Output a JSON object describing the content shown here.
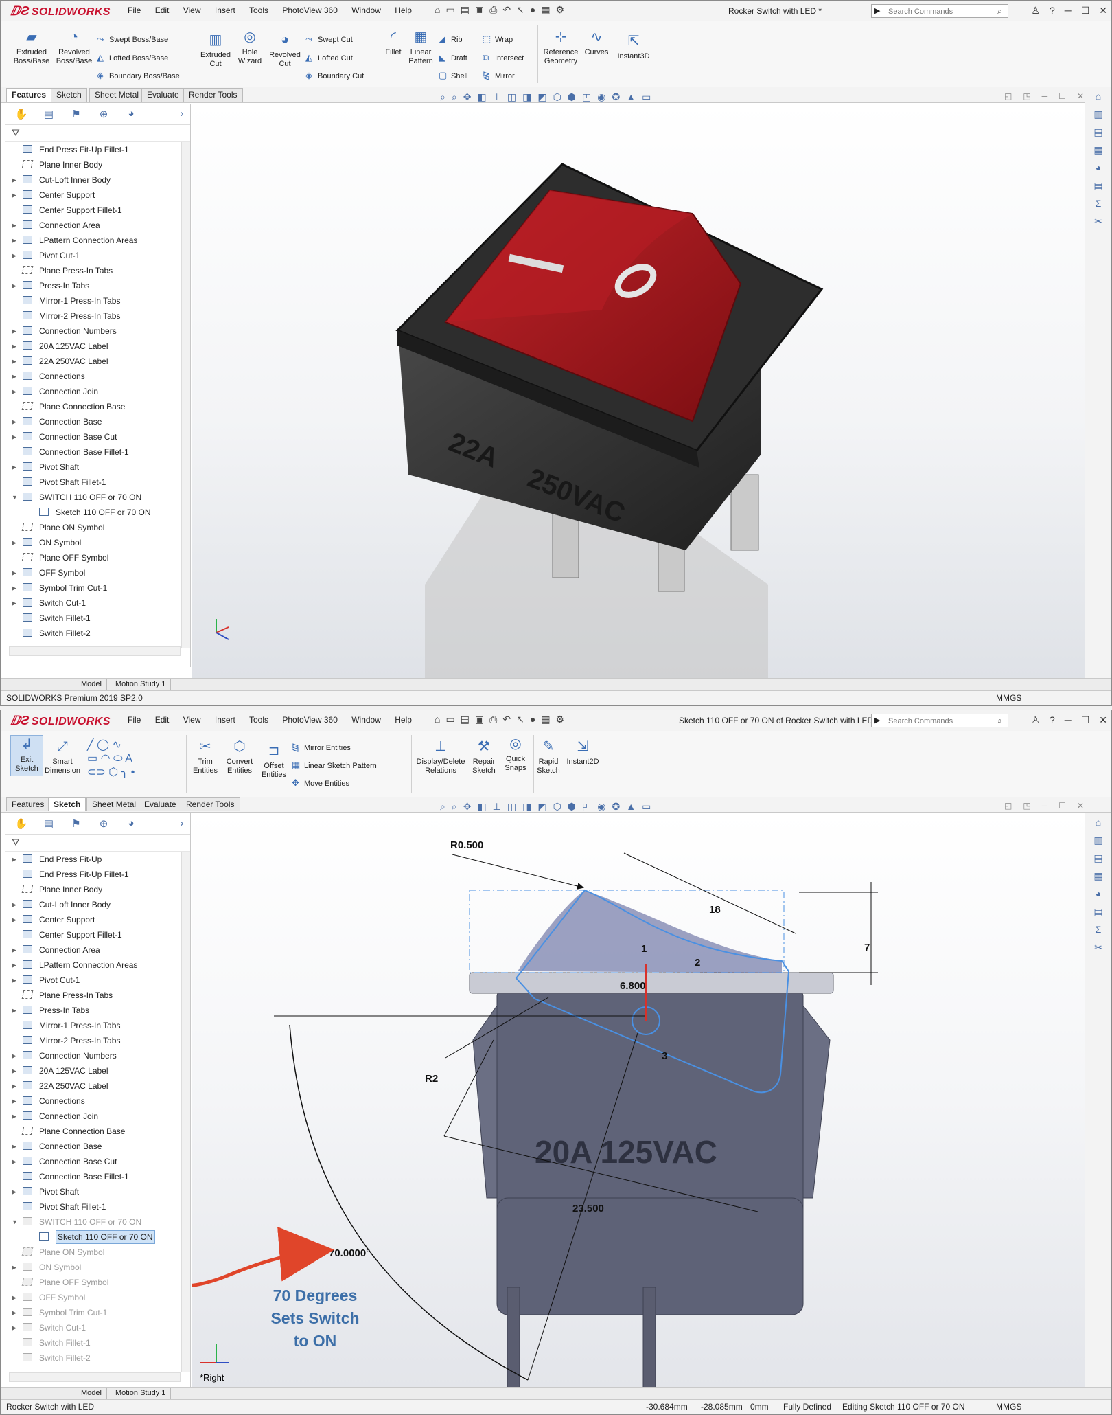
{
  "app": {
    "brand": "SOLIDWORKS",
    "menus": [
      "File",
      "Edit",
      "View",
      "Insert",
      "Tools",
      "PhotoView 360",
      "Window",
      "Help"
    ],
    "search_placeholder": "Search Commands"
  },
  "window1": {
    "title": "Rocker Switch with LED *",
    "ribbon_large": [
      {
        "label": "Extruded\nBoss/Base",
        "icon": "extrude-icon"
      },
      {
        "label": "Revolved\nBoss/Base",
        "icon": "revolve-icon"
      },
      {
        "label": "Extruded\nCut",
        "icon": "extruded-cut-icon"
      },
      {
        "label": "Hole\nWizard",
        "icon": "hole-wizard-icon"
      },
      {
        "label": "Revolved\nCut",
        "icon": "revolved-cut-icon"
      },
      {
        "label": "Fillet",
        "icon": "fillet-icon"
      },
      {
        "label": "Linear\nPattern",
        "icon": "linear-pattern-icon"
      },
      {
        "label": "Reference\nGeometry",
        "icon": "reference-geometry-icon"
      },
      {
        "label": "Curves",
        "icon": "curves-icon"
      },
      {
        "label": "Instant3D",
        "icon": "instant3d-icon"
      }
    ],
    "ribbon_small": [
      "Swept Boss/Base",
      "Lofted Boss/Base",
      "Boundary Boss/Base",
      "Swept Cut",
      "Lofted Cut",
      "Boundary Cut",
      "Rib",
      "Draft",
      "Shell",
      "Wrap",
      "Intersect",
      "Mirror"
    ],
    "tabs": [
      "Features",
      "Sketch",
      "Sheet Metal",
      "Evaluate",
      "Render Tools"
    ],
    "active_tab": "Features",
    "tree": [
      {
        "label": "End Press Fit-Up Fillet-1",
        "type": "feature",
        "exp": false
      },
      {
        "label": "Plane Inner Body",
        "type": "plane",
        "exp": false
      },
      {
        "label": "Cut-Loft Inner Body",
        "type": "feature",
        "exp": true
      },
      {
        "label": "Center Support",
        "type": "feature",
        "exp": true
      },
      {
        "label": "Center Support Fillet-1",
        "type": "feature",
        "exp": false
      },
      {
        "label": "Connection Area",
        "type": "feature",
        "exp": true
      },
      {
        "label": "LPattern Connection Areas",
        "type": "feature",
        "exp": true
      },
      {
        "label": "Pivot Cut-1",
        "type": "feature",
        "exp": true
      },
      {
        "label": "Plane Press-In Tabs",
        "type": "plane",
        "exp": false
      },
      {
        "label": "Press-In Tabs",
        "type": "feature",
        "exp": true
      },
      {
        "label": "Mirror-1 Press-In Tabs",
        "type": "feature",
        "exp": false
      },
      {
        "label": "Mirror-2 Press-In Tabs",
        "type": "feature",
        "exp": false
      },
      {
        "label": "Connection Numbers",
        "type": "feature",
        "exp": true
      },
      {
        "label": "20A  125VAC Label",
        "type": "feature",
        "exp": true
      },
      {
        "label": "22A  250VAC Label",
        "type": "feature",
        "exp": true
      },
      {
        "label": "Connections",
        "type": "feature",
        "exp": true
      },
      {
        "label": "Connection Join",
        "type": "feature",
        "exp": true
      },
      {
        "label": "Plane Connection Base",
        "type": "plane",
        "exp": false
      },
      {
        "label": "Connection Base",
        "type": "feature",
        "exp": true
      },
      {
        "label": "Connection Base Cut",
        "type": "feature",
        "exp": true
      },
      {
        "label": "Connection Base Fillet-1",
        "type": "feature",
        "exp": false
      },
      {
        "label": "Pivot Shaft",
        "type": "feature",
        "exp": true
      },
      {
        "label": "Pivot Shaft Fillet-1",
        "type": "feature",
        "exp": false
      },
      {
        "label": "SWITCH 110 OFF or 70 ON",
        "type": "feature",
        "exp": "open"
      },
      {
        "label": "Sketch 110 OFF or 70 ON",
        "type": "sketch",
        "exp": false
      },
      {
        "label": "Plane ON Symbol",
        "type": "plane",
        "exp": false
      },
      {
        "label": "ON Symbol",
        "type": "feature",
        "exp": true
      },
      {
        "label": "Plane OFF Symbol",
        "type": "plane",
        "exp": false
      },
      {
        "label": "OFF Symbol",
        "type": "feature",
        "exp": true
      },
      {
        "label": "Symbol Trim Cut-1",
        "type": "feature",
        "exp": true
      },
      {
        "label": "Switch Cut-1",
        "type": "feature",
        "exp": true
      },
      {
        "label": "Switch Fillet-1",
        "type": "feature",
        "exp": false
      },
      {
        "label": "Switch Fillet-2",
        "type": "feature",
        "exp": false
      }
    ],
    "bottom_tabs": [
      "Model",
      "Motion Study 1"
    ],
    "status_left": "SOLIDWORKS Premium 2019 SP2.0",
    "status_units": "MMGS",
    "model_text": [
      "22A",
      "250VAC"
    ],
    "symbol_on": "I",
    "symbol_off": "O"
  },
  "window2": {
    "title": "Sketch 110 OFF or 70 ON of Rocker Switch with LED *",
    "ribbon_large": [
      {
        "label": "Exit\nSketch",
        "icon": "exit-sketch-icon"
      },
      {
        "label": "Smart\nDimension",
        "icon": "smart-dimension-icon"
      },
      {
        "label": "Trim\nEntities",
        "icon": "trim-entities-icon"
      },
      {
        "label": "Convert\nEntities",
        "icon": "convert-entities-icon"
      },
      {
        "label": "Offset\nEntities",
        "icon": "offset-entities-icon"
      },
      {
        "label": "Display/Delete\nRelations",
        "icon": "relations-icon"
      },
      {
        "label": "Repair\nSketch",
        "icon": "repair-sketch-icon"
      },
      {
        "label": "Quick\nSnaps",
        "icon": "quick-snaps-icon"
      },
      {
        "label": "Rapid\nSketch",
        "icon": "rapid-sketch-icon"
      },
      {
        "label": "Instant2D",
        "icon": "instant2d-icon"
      }
    ],
    "ribbon_small": [
      "Mirror Entities",
      "Linear Sketch Pattern",
      "Move Entities"
    ],
    "tabs": [
      "Features",
      "Sketch",
      "Sheet Metal",
      "Evaluate",
      "Render Tools"
    ],
    "active_tab": "Sketch",
    "tree": [
      {
        "label": "End Press Fit-Up",
        "type": "feature",
        "exp": true
      },
      {
        "label": "End Press Fit-Up Fillet-1",
        "type": "feature",
        "exp": false
      },
      {
        "label": "Plane Inner Body",
        "type": "plane",
        "exp": false
      },
      {
        "label": "Cut-Loft Inner Body",
        "type": "feature",
        "exp": true
      },
      {
        "label": "Center Support",
        "type": "feature",
        "exp": true
      },
      {
        "label": "Center Support Fillet-1",
        "type": "feature",
        "exp": false
      },
      {
        "label": "Connection Area",
        "type": "feature",
        "exp": true
      },
      {
        "label": "LPattern Connection Areas",
        "type": "feature",
        "exp": true
      },
      {
        "label": "Pivot Cut-1",
        "type": "feature",
        "exp": true
      },
      {
        "label": "Plane Press-In Tabs",
        "type": "plane",
        "exp": false
      },
      {
        "label": "Press-In Tabs",
        "type": "feature",
        "exp": true
      },
      {
        "label": "Mirror-1 Press-In Tabs",
        "type": "feature",
        "exp": false
      },
      {
        "label": "Mirror-2 Press-In Tabs",
        "type": "feature",
        "exp": false
      },
      {
        "label": "Connection Numbers",
        "type": "feature",
        "exp": true
      },
      {
        "label": "20A  125VAC Label",
        "type": "feature",
        "exp": true
      },
      {
        "label": "22A  250VAC Label",
        "type": "feature",
        "exp": true
      },
      {
        "label": "Connections",
        "type": "feature",
        "exp": true
      },
      {
        "label": "Connection Join",
        "type": "feature",
        "exp": true
      },
      {
        "label": "Plane Connection Base",
        "type": "plane",
        "exp": false
      },
      {
        "label": "Connection Base",
        "type": "feature",
        "exp": true
      },
      {
        "label": "Connection Base Cut",
        "type": "feature",
        "exp": true
      },
      {
        "label": "Connection Base Fillet-1",
        "type": "feature",
        "exp": false
      },
      {
        "label": "Pivot Shaft",
        "type": "feature",
        "exp": true
      },
      {
        "label": "Pivot Shaft Fillet-1",
        "type": "feature",
        "exp": false
      },
      {
        "label": "SWITCH 110 OFF or 70 ON",
        "type": "feature",
        "exp": "open",
        "dim": true
      },
      {
        "label": "Sketch 110 OFF or 70 ON",
        "type": "sketch",
        "exp": false,
        "sel": true
      },
      {
        "label": "Plane ON Symbol",
        "type": "plane",
        "exp": false,
        "dim": true
      },
      {
        "label": "ON Symbol",
        "type": "feature",
        "exp": true,
        "dim": true
      },
      {
        "label": "Plane OFF Symbol",
        "type": "plane",
        "exp": false,
        "dim": true
      },
      {
        "label": "OFF Symbol",
        "type": "feature",
        "exp": true,
        "dim": true
      },
      {
        "label": "Symbol Trim Cut-1",
        "type": "feature",
        "exp": true,
        "dim": true
      },
      {
        "label": "Switch Cut-1",
        "type": "feature",
        "exp": true,
        "dim": true
      },
      {
        "label": "Switch Fillet-1",
        "type": "feature",
        "exp": false,
        "dim": true
      },
      {
        "label": "Switch Fillet-2",
        "type": "feature",
        "exp": false,
        "dim": true
      }
    ],
    "bottom_tabs": [
      "Model",
      "Motion Study 1"
    ],
    "status_left": "Rocker Switch with LED",
    "status_x": "-30.684mm",
    "status_y": "-28.085mm",
    "status_z": "0mm",
    "status_defined": "Fully Defined",
    "status_editing": "Editing Sketch 110 OFF or 70 ON",
    "status_units": "MMGS",
    "view_label": "*Right",
    "model_text": "20A  125VAC",
    "dims": {
      "r05": "R0.500",
      "d18": "18",
      "d7": "7",
      "d1": "1",
      "d2": "2",
      "d6800": "6.800",
      "d3": "3",
      "r2": "R2",
      "d23500": "23.500",
      "angle": "70.0000°"
    },
    "callout": [
      "70 Degrees",
      "Sets Switch",
      "to ON"
    ]
  },
  "colors": {
    "accent_blue": "#3d6fa8",
    "arrow_red": "#e0452a",
    "sketch_blue": "#4a90e2",
    "switch_red": "#a3151a",
    "housing_dark": "#333333"
  }
}
